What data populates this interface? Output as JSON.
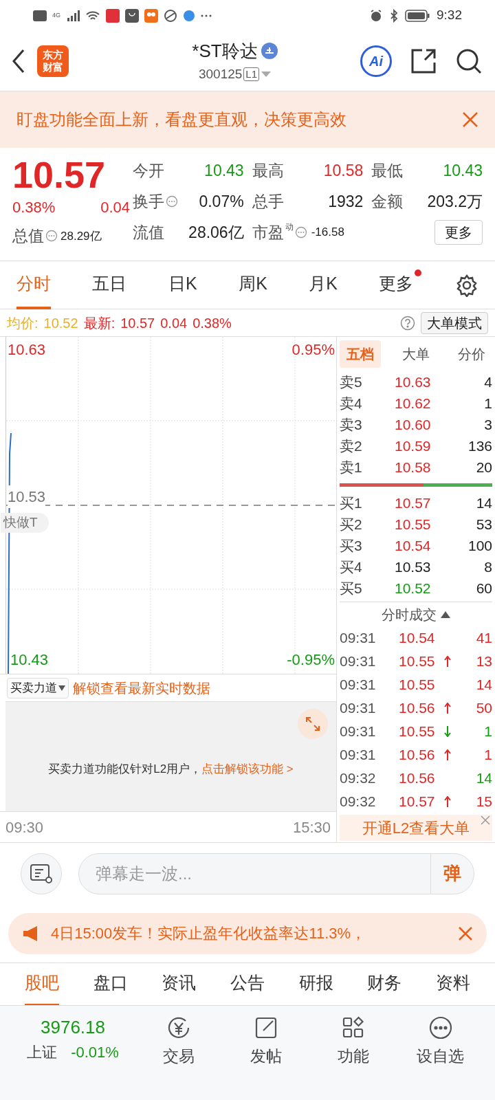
{
  "status_bar": {
    "time": "9:32",
    "network": "4G"
  },
  "header": {
    "logo": "东方财富",
    "title": "*ST聆达",
    "code": "300125",
    "level_badge": "L1",
    "ai_label": "Ai"
  },
  "banner": {
    "text": "盯盘功能全面上新，看盘更直观，决策更高效"
  },
  "quote": {
    "price": "10.57",
    "change_pct": "0.38%",
    "change": "0.04",
    "stats": [
      {
        "label": "今开",
        "value": "10.43",
        "color": "#159b15",
        "info": false
      },
      {
        "label": "最高",
        "value": "10.58",
        "color": "#e02727",
        "info": false
      },
      {
        "label": "最低",
        "value": "10.43",
        "color": "#159b15",
        "info": false
      },
      {
        "label": "换手",
        "value": "0.07%",
        "color": "#222222",
        "info": true
      },
      {
        "label": "总手",
        "value": "1932",
        "color": "#222222",
        "info": false
      },
      {
        "label": "金额",
        "value": "203.2万",
        "color": "#222222",
        "info": false
      }
    ],
    "market_cap_label": "总值",
    "market_cap": "28.29亿",
    "float_label": "流值",
    "float_value": "28.06亿",
    "pe_label": "市盈",
    "pe_sup": "动",
    "pe_value": "-16.58",
    "more": "更多"
  },
  "chart_tabs": [
    {
      "label": "分时",
      "selected": true,
      "dot": false
    },
    {
      "label": "五日",
      "selected": false,
      "dot": false
    },
    {
      "label": "日K",
      "selected": false,
      "dot": false
    },
    {
      "label": "周K",
      "selected": false,
      "dot": false
    },
    {
      "label": "月K",
      "selected": false,
      "dot": false
    },
    {
      "label": "更多",
      "selected": false,
      "dot": true
    }
  ],
  "info_line": {
    "avg_label": "均价:",
    "avg": "10.52",
    "latest_label": "最新:",
    "latest": "10.57",
    "change": "0.04",
    "change_pct": "0.38%",
    "mode_button": "大单模式"
  },
  "chart": {
    "top_price": "10.63",
    "top_pct": "0.95%",
    "mid_price": "10.53",
    "bottom_price": "10.43",
    "bottom_pct": "-0.95%",
    "overlay_pill": "快做T",
    "start_time": "09:30",
    "end_time": "15:30"
  },
  "sub_chart": {
    "selector": "买卖力道",
    "unlock_link": "解锁查看最新实时数据",
    "notice": "买卖力道功能仅针对L2用户，",
    "notice_link": "点击解锁该功能 >"
  },
  "book_tabs": [
    {
      "label": "五档",
      "selected": true
    },
    {
      "label": "大单",
      "selected": false
    },
    {
      "label": "分价",
      "selected": false
    }
  ],
  "asks": [
    {
      "label": "卖5",
      "price": "10.63",
      "volume": "4",
      "color": "#e02727"
    },
    {
      "label": "卖4",
      "price": "10.62",
      "volume": "1",
      "color": "#e02727"
    },
    {
      "label": "卖3",
      "price": "10.60",
      "volume": "3",
      "color": "#e02727"
    },
    {
      "label": "卖2",
      "price": "10.59",
      "volume": "136",
      "color": "#e02727"
    },
    {
      "label": "卖1",
      "price": "10.58",
      "volume": "20",
      "color": "#e02727"
    }
  ],
  "ratio": {
    "level": 0.55
  },
  "bids": [
    {
      "label": "买1",
      "price": "10.57",
      "volume": "14",
      "color": "#e02727"
    },
    {
      "label": "买2",
      "price": "10.55",
      "volume": "53",
      "color": "#e02727"
    },
    {
      "label": "买3",
      "price": "10.54",
      "volume": "100",
      "color": "#e02727"
    },
    {
      "label": "买4",
      "price": "10.53",
      "volume": "8",
      "color": "#222222"
    },
    {
      "label": "买5",
      "price": "10.52",
      "volume": "60",
      "color": "#159b15"
    }
  ],
  "trades_title": "分时成交",
  "trades": [
    {
      "time": "09:31",
      "price": "10.54",
      "volume": "41",
      "kind": "plain",
      "color": "#e02727"
    },
    {
      "time": "09:31",
      "price": "10.55",
      "volume": "13",
      "kind": "up",
      "color": "#e02727"
    },
    {
      "time": "09:31",
      "price": "10.55",
      "volume": "14",
      "kind": "plain",
      "color": "#e02727"
    },
    {
      "time": "09:31",
      "price": "10.56",
      "volume": "50",
      "kind": "up",
      "color": "#e02727"
    },
    {
      "time": "09:31",
      "price": "10.55",
      "volume": "1",
      "kind": "down",
      "color": "#159b15"
    },
    {
      "time": "09:31",
      "price": "10.56",
      "volume": "1",
      "kind": "up",
      "color": "#e02727"
    },
    {
      "time": "09:32",
      "price": "10.56",
      "volume": "14",
      "kind": "plain",
      "color": "#159b15"
    },
    {
      "time": "09:32",
      "price": "10.57",
      "volume": "15",
      "kind": "up",
      "color": "#e02727"
    }
  ],
  "l2_promo": "开通L2查看大单",
  "comment": {
    "placeholder": "弹幕走一波...",
    "send": "弹"
  },
  "ticker": {
    "text": "4日15:00发车！实际止盈年化收益率达11.3%，"
  },
  "section_tabs": [
    {
      "label": "股吧",
      "selected": true
    },
    {
      "label": "盘口",
      "selected": false
    },
    {
      "label": "资讯",
      "selected": false
    },
    {
      "label": "公告",
      "selected": false
    },
    {
      "label": "研报",
      "selected": false
    },
    {
      "label": "财务",
      "selected": false
    },
    {
      "label": "资料",
      "selected": false
    }
  ],
  "index": {
    "value": "3976.18",
    "name": "上证",
    "change": "-0.01%",
    "color": "#159b15"
  },
  "nav": [
    {
      "label": "交易",
      "kind": "trade"
    },
    {
      "label": "发帖",
      "kind": "post"
    },
    {
      "label": "功能",
      "kind": "apps"
    },
    {
      "label": "设自选",
      "kind": "more"
    }
  ]
}
